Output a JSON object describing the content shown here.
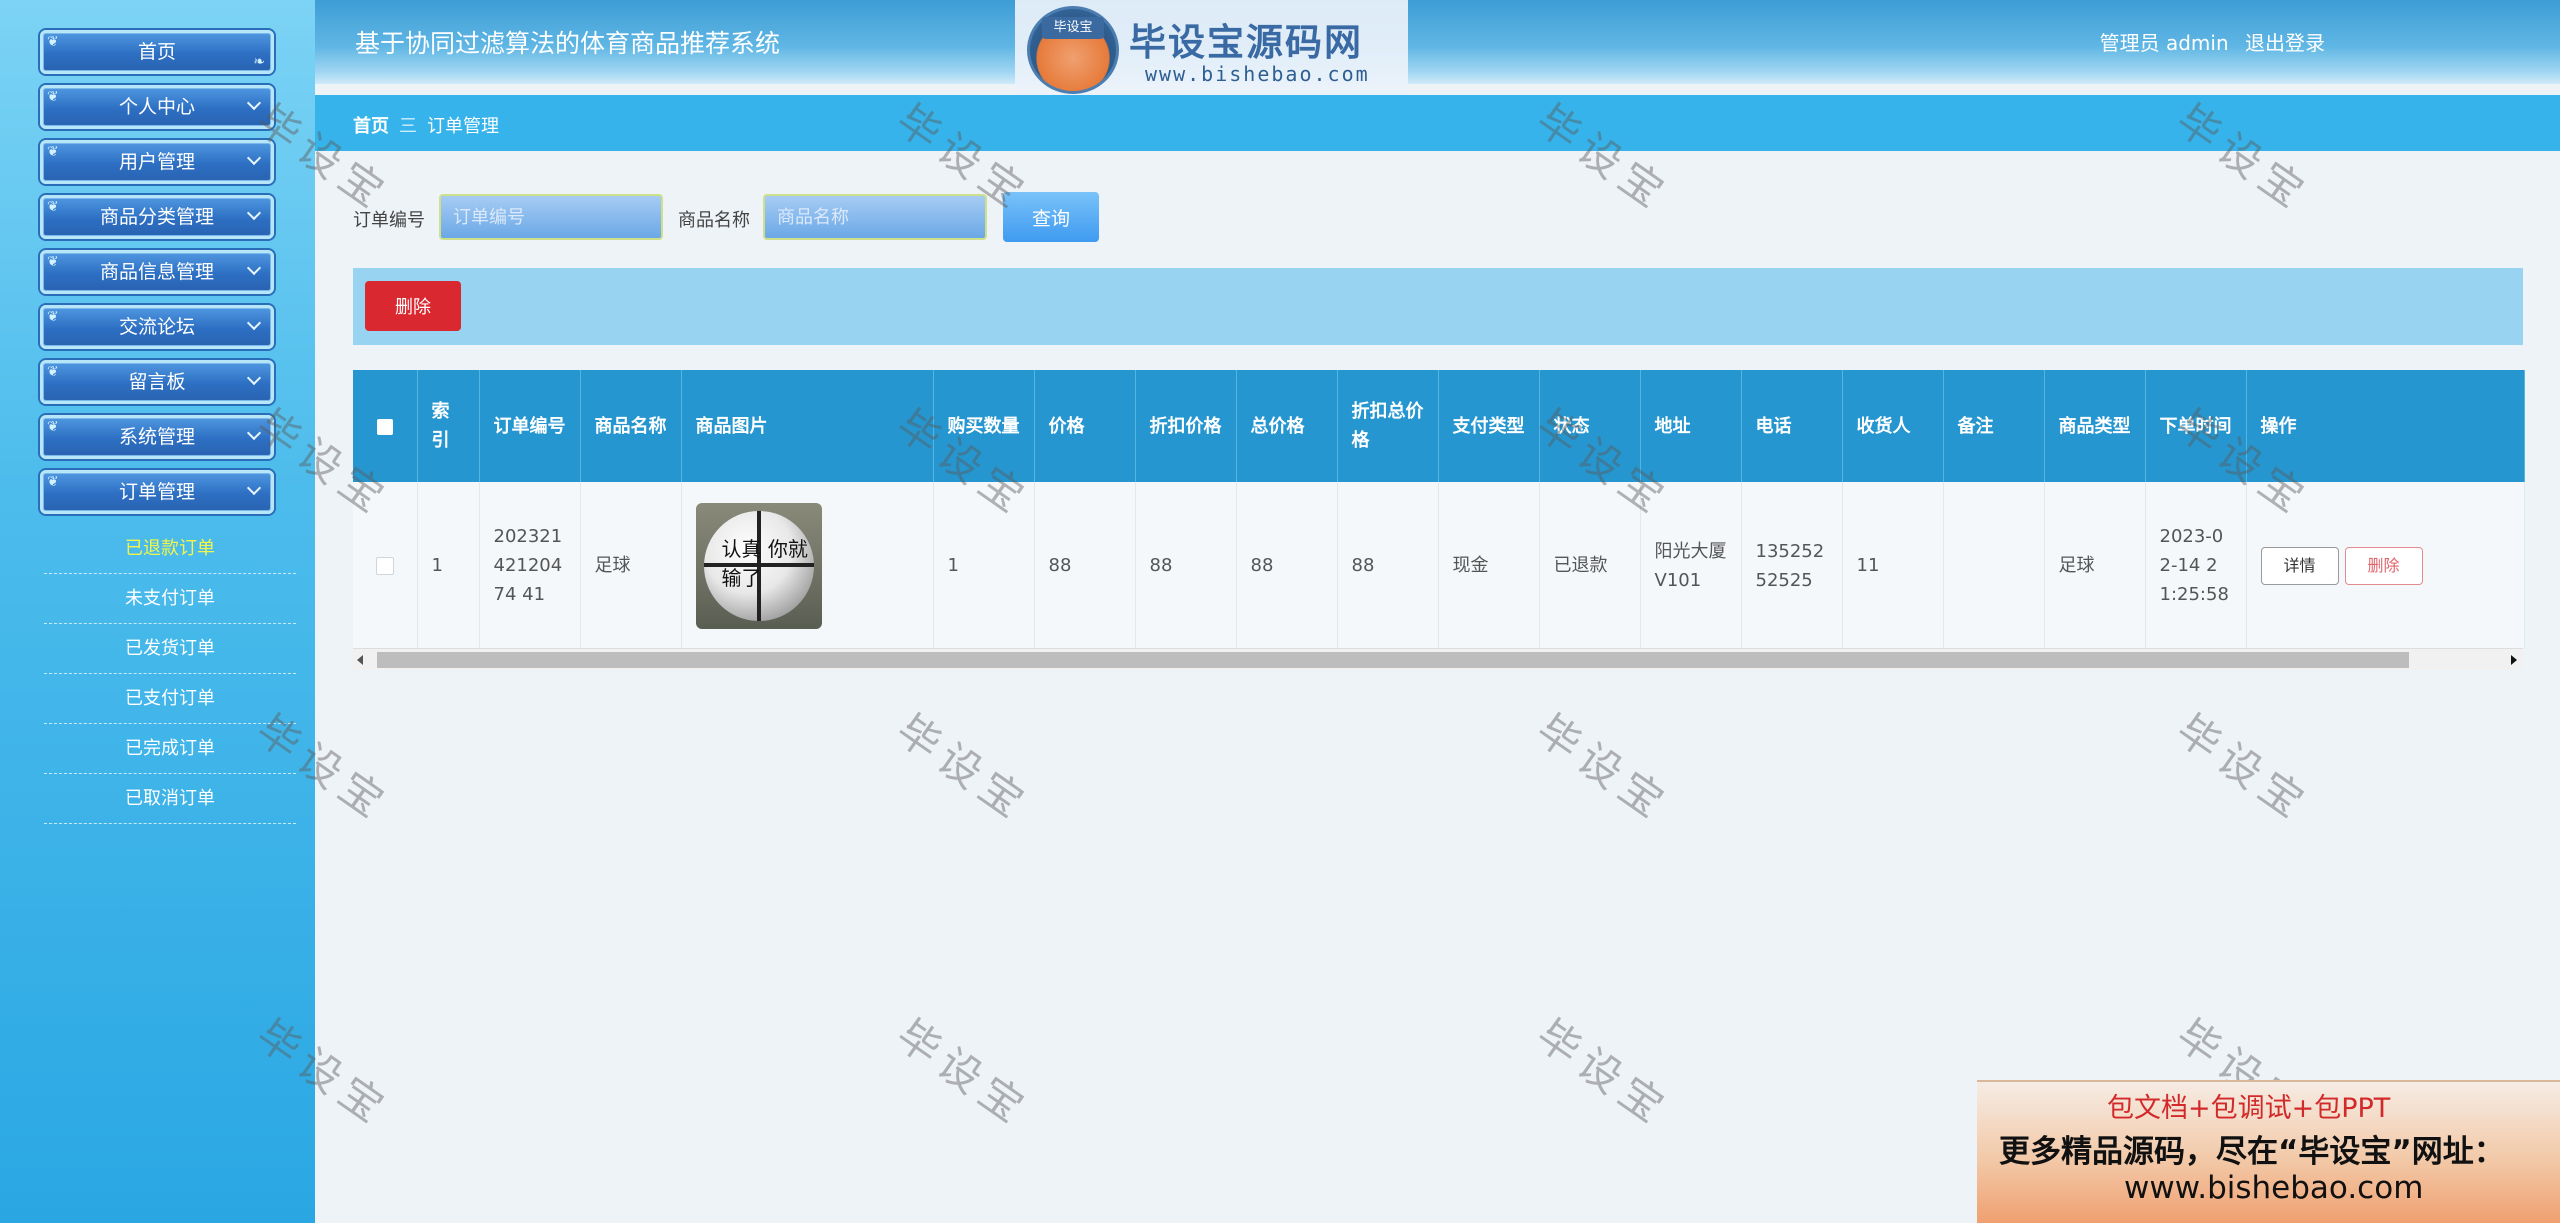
{
  "header": {
    "title": "基于协同过滤算法的体育商品推荐系统",
    "user_label": "管理员 admin",
    "logout_label": "退出登录"
  },
  "logo": {
    "badge": "毕设宝",
    "name": "毕设宝源码网",
    "url": "www.bishebao.com"
  },
  "sidebar": {
    "items": [
      {
        "label": "首页"
      },
      {
        "label": "个人中心"
      },
      {
        "label": "用户管理"
      },
      {
        "label": "商品分类管理"
      },
      {
        "label": "商品信息管理"
      },
      {
        "label": "交流论坛"
      },
      {
        "label": "留言板"
      },
      {
        "label": "系统管理"
      },
      {
        "label": "订单管理"
      }
    ],
    "subitems": [
      {
        "label": "已退款订单",
        "active": true
      },
      {
        "label": "未支付订单"
      },
      {
        "label": "已发货订单"
      },
      {
        "label": "已支付订单"
      },
      {
        "label": "已完成订单"
      },
      {
        "label": "已取消订单"
      }
    ]
  },
  "breadcrumb": {
    "home": "首页",
    "separator": "三",
    "current": "订单管理"
  },
  "search": {
    "order_no_label": "订单编号",
    "order_no_placeholder": "订单编号",
    "goods_name_label": "商品名称",
    "goods_name_placeholder": "商品名称",
    "query_button": "查询"
  },
  "actions": {
    "delete_button": "删除"
  },
  "table": {
    "headers": [
      "索引",
      "订单编号",
      "商品名称",
      "商品图片",
      "购买数量",
      "价格",
      "折扣价格",
      "总价格",
      "折扣总价格",
      "支付类型",
      "状态",
      "地址",
      "电话",
      "收货人",
      "备注",
      "商品类型",
      "下单时间",
      "操作"
    ],
    "rows": [
      {
        "index": "1",
        "order_no": "20232142120474 41",
        "goods_name": "足球",
        "image_text": "认真 你就输了",
        "quantity": "1",
        "price": "88",
        "discount_price": "88",
        "total_price": "88",
        "discount_total": "88",
        "pay_type": "现金",
        "status": "已退款",
        "address": "阳光大厦V101",
        "phone": "13525252525",
        "receiver": "11",
        "note": "",
        "goods_type": "足球",
        "order_time": "2023-02-14 21:25:58",
        "detail_button": "详情",
        "delete_button": "删除"
      }
    ]
  },
  "watermark": "毕设宝",
  "ad": {
    "line1": "包文档+包调试+包PPT",
    "line2": "更多精品源码，尽在“毕设宝”网址：",
    "line3": "www.bishebao.com"
  },
  "colors": {
    "sidebar_top": "#7cd3f5",
    "menu_button": "#2d6fc3",
    "active_submenu": "#f3f54a",
    "table_header": "#2596cf",
    "delete_red": "#d9282f",
    "query_blue": "#3f9af0"
  }
}
